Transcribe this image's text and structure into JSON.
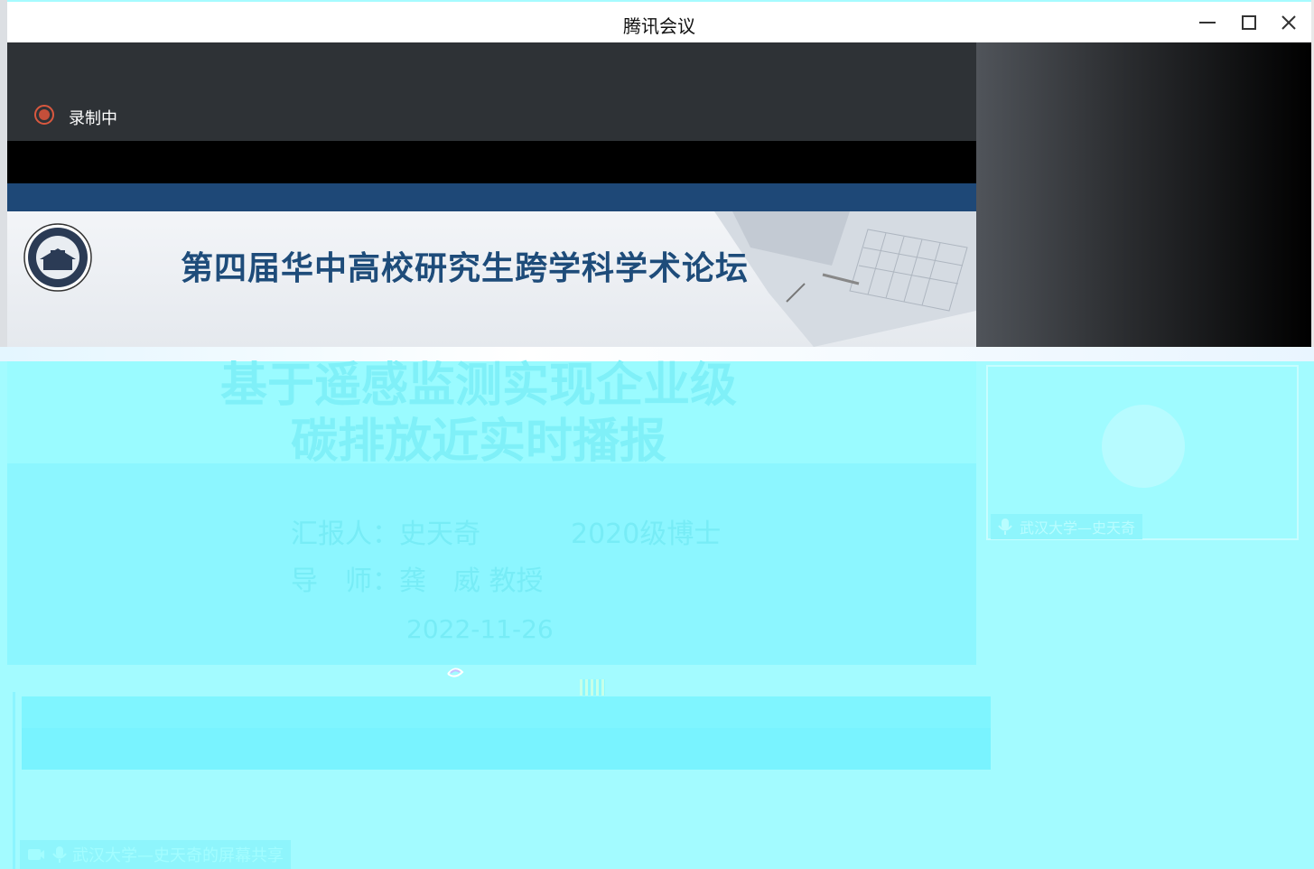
{
  "window": {
    "title": "腾讯会议"
  },
  "recording": {
    "label": "录制中"
  },
  "slide": {
    "forum_title": "第四届华中高校研究生跨学科学术论坛",
    "topic_line_1": "基于遥感监测实现企业级",
    "topic_line_2": "碳排放近实时播报",
    "reporter": "汇报人：史天奇",
    "degree": "2020级博士",
    "advisor": "导　师：龚　威  教授",
    "date": "2022-11-26"
  },
  "participant": {
    "name": "武汉大学—史天奇"
  },
  "screen_share": {
    "label": "武汉大学—史天奇的屏幕共享"
  },
  "colors": {
    "record": "#c44f3a",
    "slide_blue": "#1e4877",
    "title_blue": "#1e4c7a",
    "glitch_cyan": "#a3fbff"
  }
}
